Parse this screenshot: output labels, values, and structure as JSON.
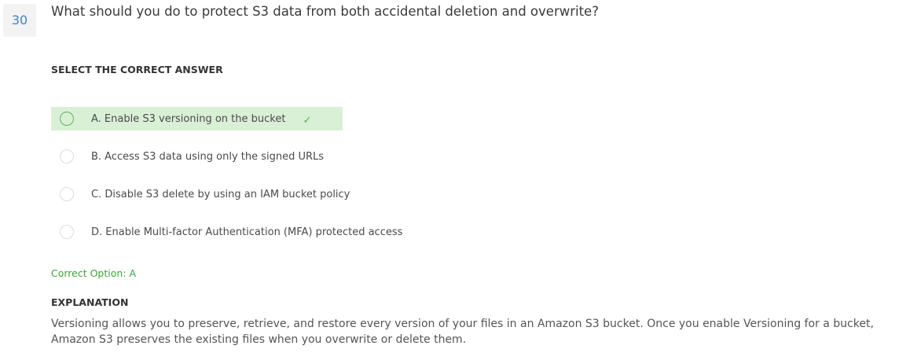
{
  "question": {
    "number": "30",
    "text": "What should you do to protect S3 data from both accidental deletion and overwrite?"
  },
  "instruction": "SELECT THE CORRECT ANSWER",
  "options": [
    {
      "label": "A. Enable S3 versioning on the bucket",
      "correct": true
    },
    {
      "label": "B. Access S3 data using only the signed URLs",
      "correct": false
    },
    {
      "label": "C. Disable S3 delete by using an IAM bucket policy",
      "correct": false
    },
    {
      "label": "D. Enable Multi-factor Authentication (MFA) protected access",
      "correct": false
    }
  ],
  "correct_option_text": "Correct Option: A",
  "explanation": {
    "heading": "EXPLANATION",
    "text": "Versioning allows you to preserve, retrieve, and restore every version of your files in an Amazon S3 bucket. Once you enable Versioning for a bucket, Amazon S3 preserves the existing files when you overwrite or delete them."
  },
  "colors": {
    "correct_bg": "#d9f0d6",
    "correct_text": "#3da33a",
    "number_color": "#3b86c8"
  },
  "icons": {
    "correct_marker": "checkmark-icon",
    "check_glyph": "✓"
  }
}
